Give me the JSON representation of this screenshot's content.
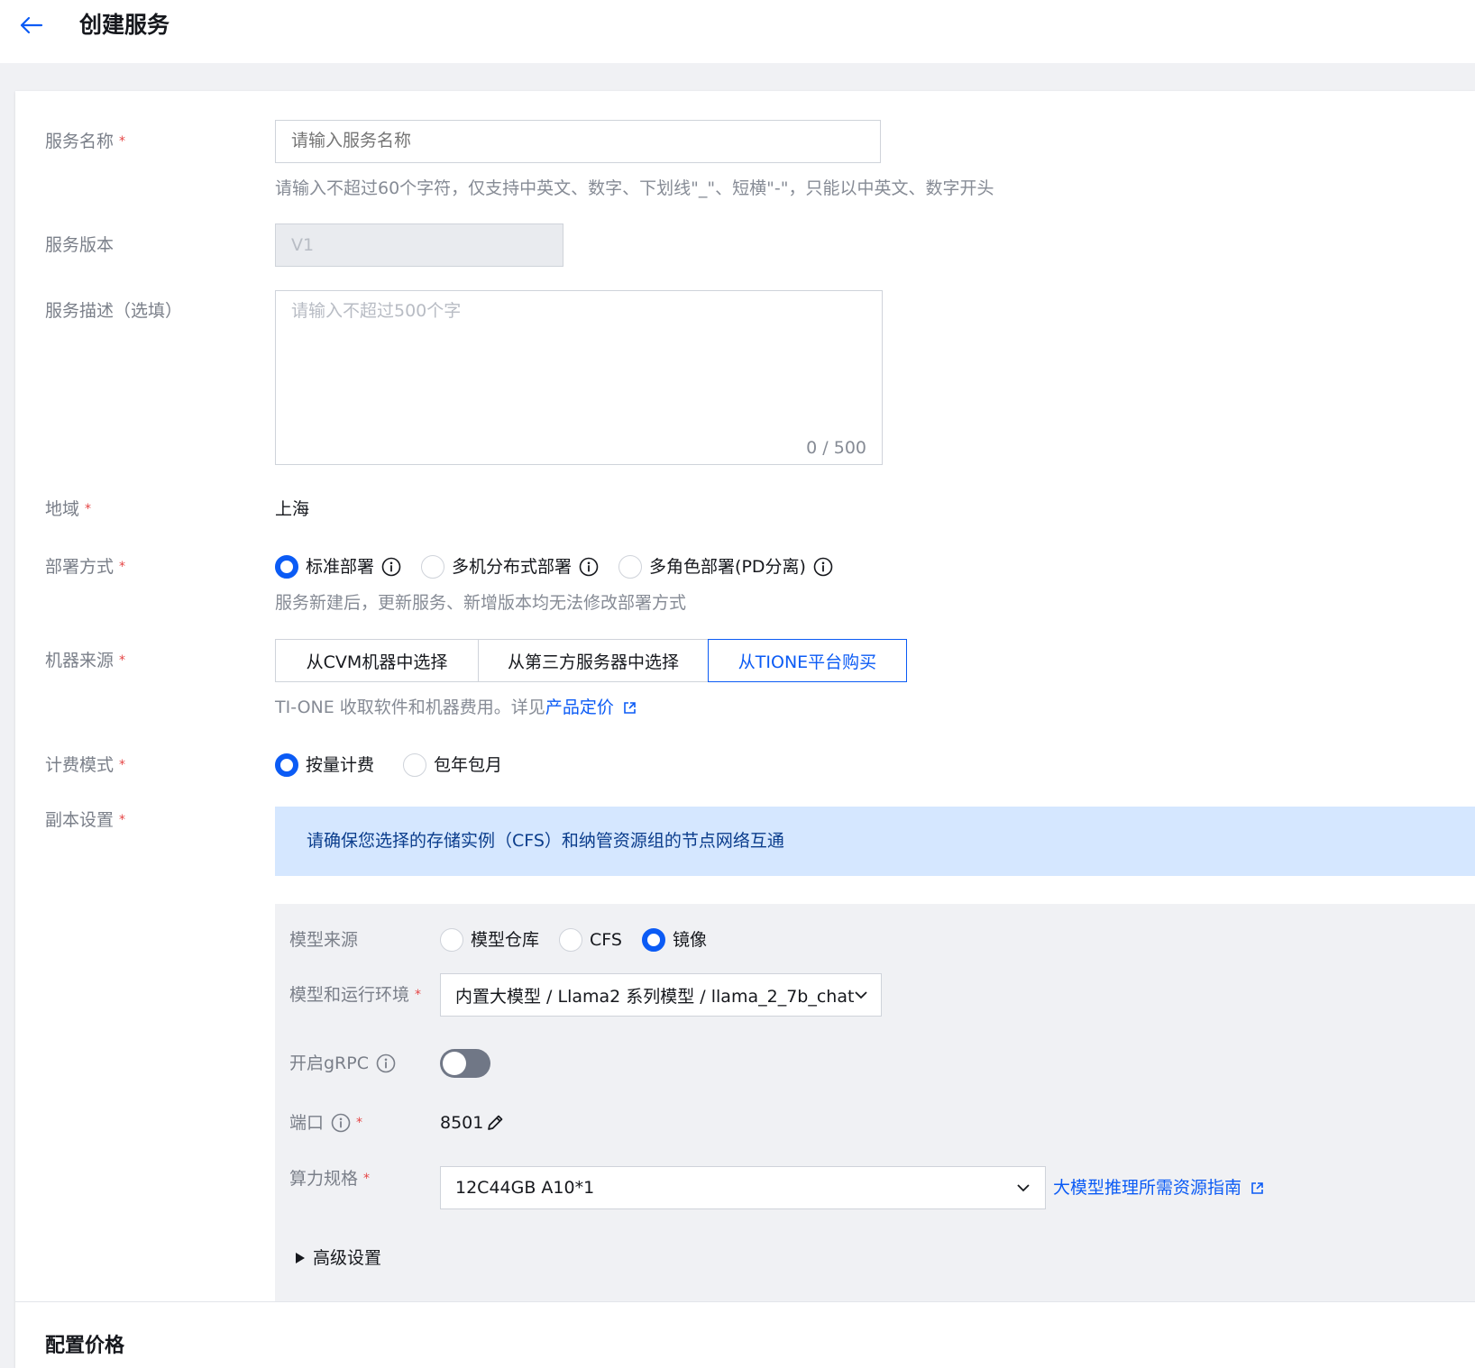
{
  "header": {
    "title": "创建服务"
  },
  "form": {
    "service_name": {
      "label": "服务名称",
      "placeholder": "请输入服务名称",
      "value": "",
      "hint": "请输入不超过60个字符，仅支持中英文、数字、下划线\"_\"、短横\"-\"，只能以中英文、数字开头"
    },
    "service_version": {
      "label": "服务版本",
      "value": "V1"
    },
    "service_desc": {
      "label": "服务描述（选填）",
      "placeholder": "请输入不超过500个字",
      "counter": "0 / 500"
    },
    "region": {
      "label": "地域",
      "value": "上海"
    },
    "deploy_mode": {
      "label": "部署方式",
      "options": [
        "标准部署",
        "多机分布式部署",
        "多角色部署(PD分离)"
      ],
      "selected": "标准部署",
      "hint": "服务新建后，更新服务、新增版本均无法修改部署方式"
    },
    "machine_source": {
      "label": "机器来源",
      "options": [
        "从CVM机器中选择",
        "从第三方服务器中选择",
        "从TIONE平台购买"
      ],
      "selected": "从TIONE平台购买",
      "hint_prefix": "TI-ONE 收取软件和机器费用。详见",
      "hint_link": "产品定价"
    },
    "billing_mode": {
      "label": "计费模式",
      "options": [
        "按量计费",
        "包年包月"
      ],
      "selected": "按量计费"
    },
    "replica": {
      "label": "副本设置",
      "notice": "请确保您选择的存储实例（CFS）和纳管资源组的节点网络互通",
      "model_source": {
        "label": "模型来源",
        "options": [
          "模型仓库",
          "CFS",
          "镜像"
        ],
        "selected": "镜像"
      },
      "model_env": {
        "label": "模型和运行环境",
        "value": "内置大模型 / Llama2 系列模型 / llama_2_7b_chat"
      },
      "grpc": {
        "label": "开启gRPC",
        "enabled": false
      },
      "port": {
        "label": "端口",
        "value": "8501"
      },
      "compute_spec": {
        "label": "算力规格",
        "value": "12C44GB A10*1",
        "guide_link": "大模型推理所需资源指南"
      },
      "advanced": {
        "label": "高级设置"
      }
    }
  },
  "pricing": {
    "title": "配置价格"
  },
  "colors": {
    "primary": "#0b5bf5",
    "required": "#e54545",
    "notice_bg": "#d5e7ff",
    "panel_bg": "#f0f1f4"
  }
}
